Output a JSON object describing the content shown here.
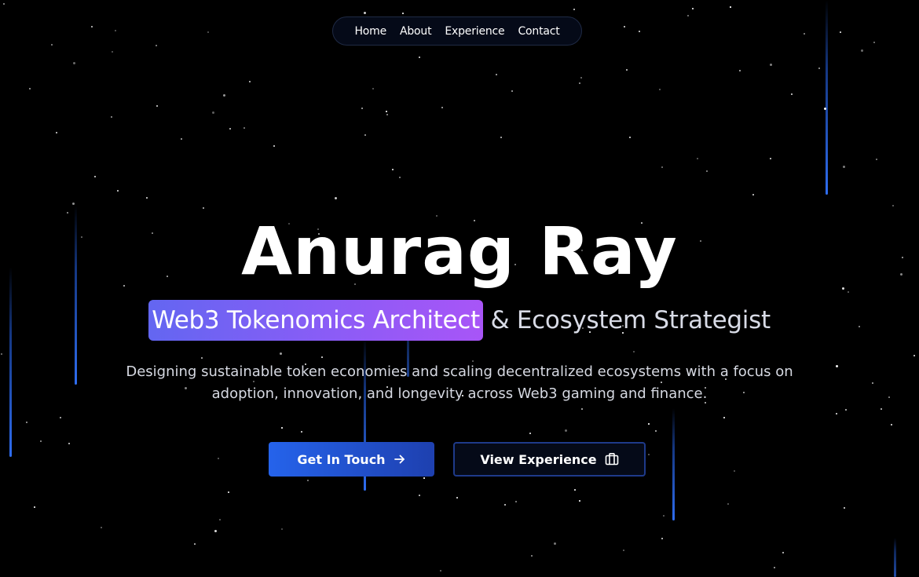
{
  "nav": {
    "items": [
      "Home",
      "About",
      "Experience",
      "Contact"
    ]
  },
  "hero": {
    "name": "Anurag Ray",
    "role_highlight": "Web3 Tokenomics Architect",
    "role_rest": " & Ecosystem Strategist",
    "description": "Designing sustainable token economies and scaling decentralized ecosystems with a focus on adoption, innovation, and longevity across Web3 gaming and finance."
  },
  "buttons": {
    "primary_label": "Get In Touch",
    "primary_icon": "arrow-right-icon",
    "secondary_label": "View Experience",
    "secondary_icon": "briefcase-icon"
  },
  "colors": {
    "background": "#000000",
    "accent_blue": "#2563eb",
    "highlight_start": "#6366f1",
    "highlight_end": "#a855f7"
  }
}
